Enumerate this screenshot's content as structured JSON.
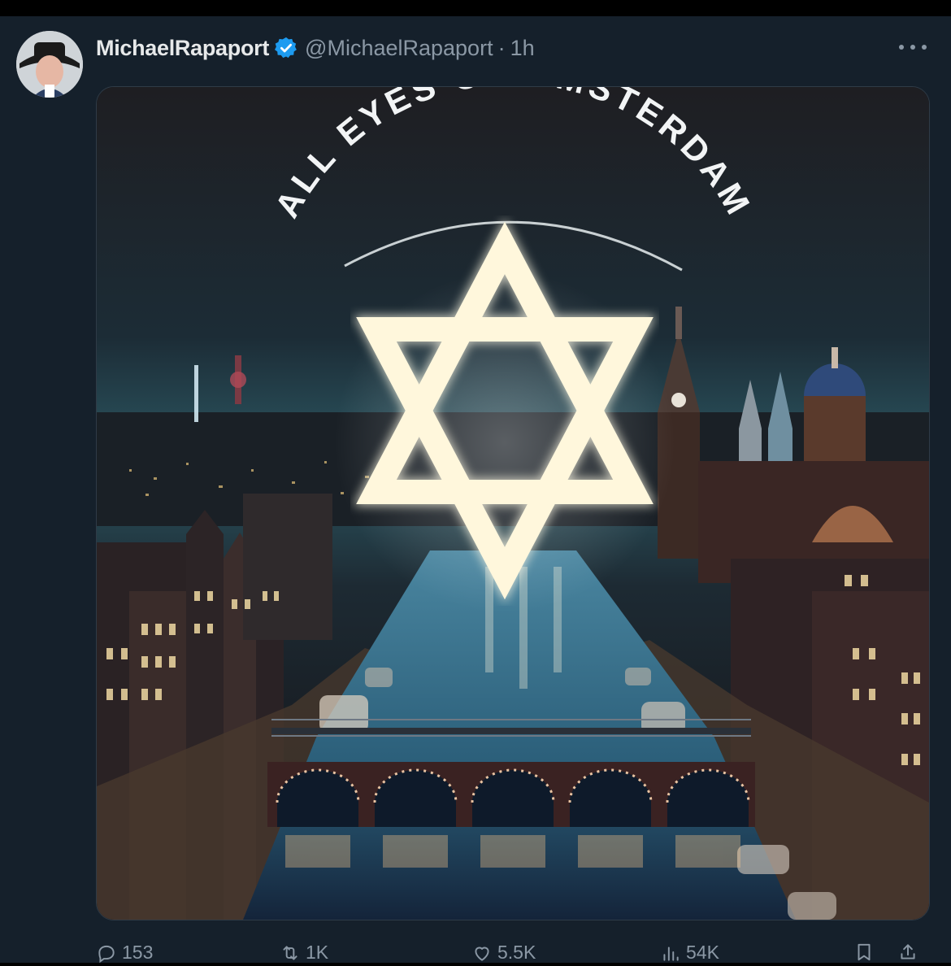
{
  "tweet": {
    "display_name": "MichaelRapaport",
    "handle": "@MichaelRapaport",
    "separator": "·",
    "timestamp": "1h",
    "more_icon": "more-horizontal-icon",
    "verified_icon": "verified-badge-icon",
    "verified_color": "#1d9bf0",
    "media": {
      "headline": "ALL EYES ON AMSTERDAM",
      "symbol": "star-of-david"
    }
  },
  "actions": {
    "reply": {
      "icon": "reply-icon",
      "count": "153"
    },
    "retweet": {
      "icon": "retweet-icon",
      "count": "1K"
    },
    "like": {
      "icon": "like-icon",
      "count": "5.5K"
    },
    "views": {
      "icon": "views-icon",
      "count": "54K"
    },
    "bookmark": {
      "icon": "bookmark-icon"
    },
    "share": {
      "icon": "share-icon"
    }
  },
  "colors": {
    "background": "#15202b",
    "text_primary": "#e7e9ea",
    "text_secondary": "#8b98a5"
  }
}
